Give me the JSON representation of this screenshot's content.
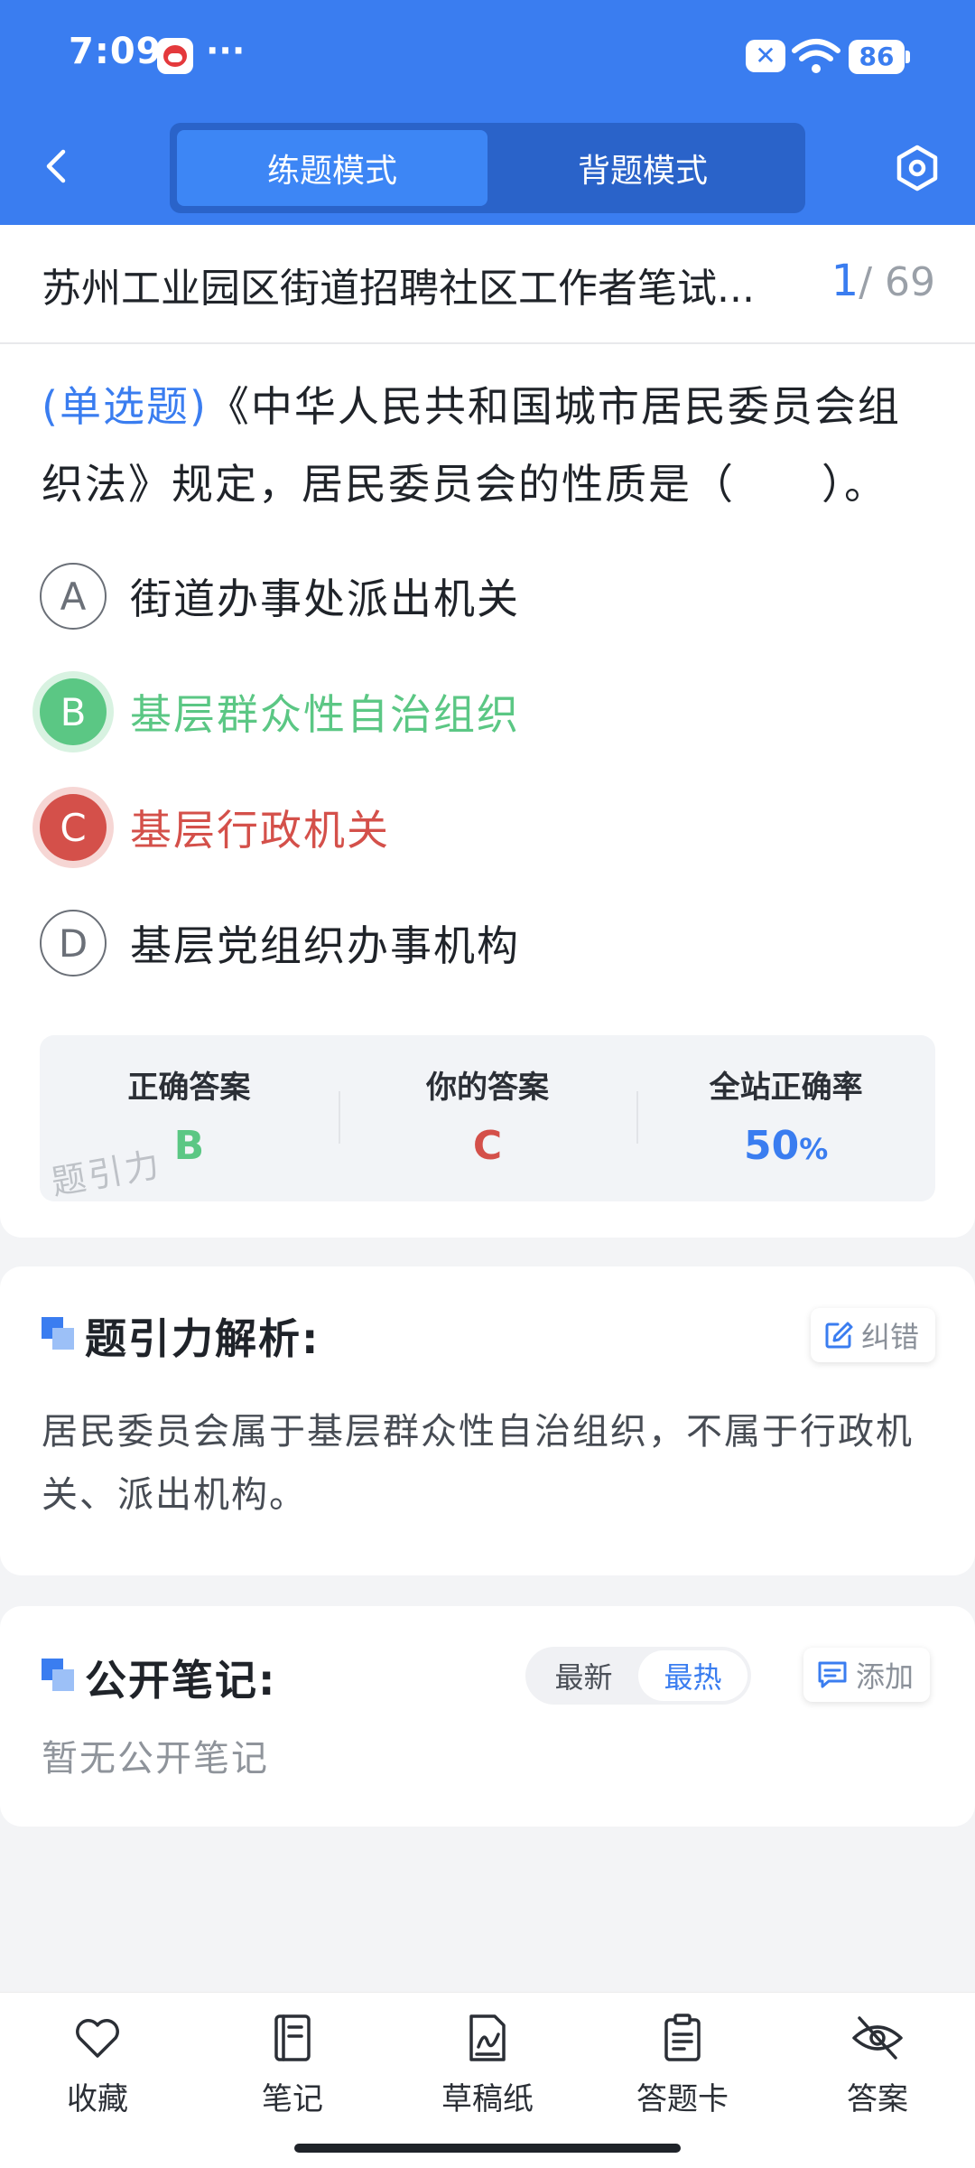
{
  "status_bar": {
    "time": "7:09",
    "dots": "···",
    "notification_badge": "✕",
    "battery": "86"
  },
  "header": {
    "tabs": [
      {
        "label": "练题模式",
        "active": true
      },
      {
        "label": "背题模式",
        "active": false
      }
    ],
    "accent_color": "#3a7df0"
  },
  "title_row": {
    "exam_title": "苏州工业园区街道招聘社区工作者笔试...",
    "current": "1",
    "total": "/ 69"
  },
  "question": {
    "type_label": "(单选题)",
    "text": "《中华人民共和国城市居民委员会组织法》规定，居民委员会的性质是（　　）。",
    "options": [
      {
        "letter": "A",
        "text": "街道办事处派出机关",
        "state": "normal"
      },
      {
        "letter": "B",
        "text": "基层群众性自治组织",
        "state": "correct"
      },
      {
        "letter": "C",
        "text": "基层行政机关",
        "state": "wrong"
      },
      {
        "letter": "D",
        "text": "基层党组织办事机构",
        "state": "normal"
      }
    ]
  },
  "answer_summary": {
    "correct_label": "正确答案",
    "correct_value": "B",
    "yours_label": "你的答案",
    "yours_value": "C",
    "rate_label": "全站正确率",
    "rate_value": "50",
    "rate_unit": "%",
    "watermark": "题引力"
  },
  "analysis": {
    "title": "题引力解析:",
    "report_label": "纠错",
    "text": "居民委员会属于基层群众性自治组织，不属于行政机关、派出机构。"
  },
  "notes": {
    "title": "公开笔记:",
    "sort_options": [
      {
        "label": "最新",
        "active": false
      },
      {
        "label": "最热",
        "active": true
      }
    ],
    "add_label": "添加",
    "empty_text": "暂无公开笔记"
  },
  "bottom_bar": [
    {
      "label": "收藏",
      "icon": "heart-icon"
    },
    {
      "label": "笔记",
      "icon": "notebook-icon"
    },
    {
      "label": "草稿纸",
      "icon": "draft-paper-icon"
    },
    {
      "label": "答题卡",
      "icon": "answer-sheet-icon"
    },
    {
      "label": "答案",
      "icon": "eye-off-icon"
    }
  ],
  "colors": {
    "correct": "#5bc784",
    "wrong": "#d4504a",
    "accent": "#3a7df0"
  }
}
